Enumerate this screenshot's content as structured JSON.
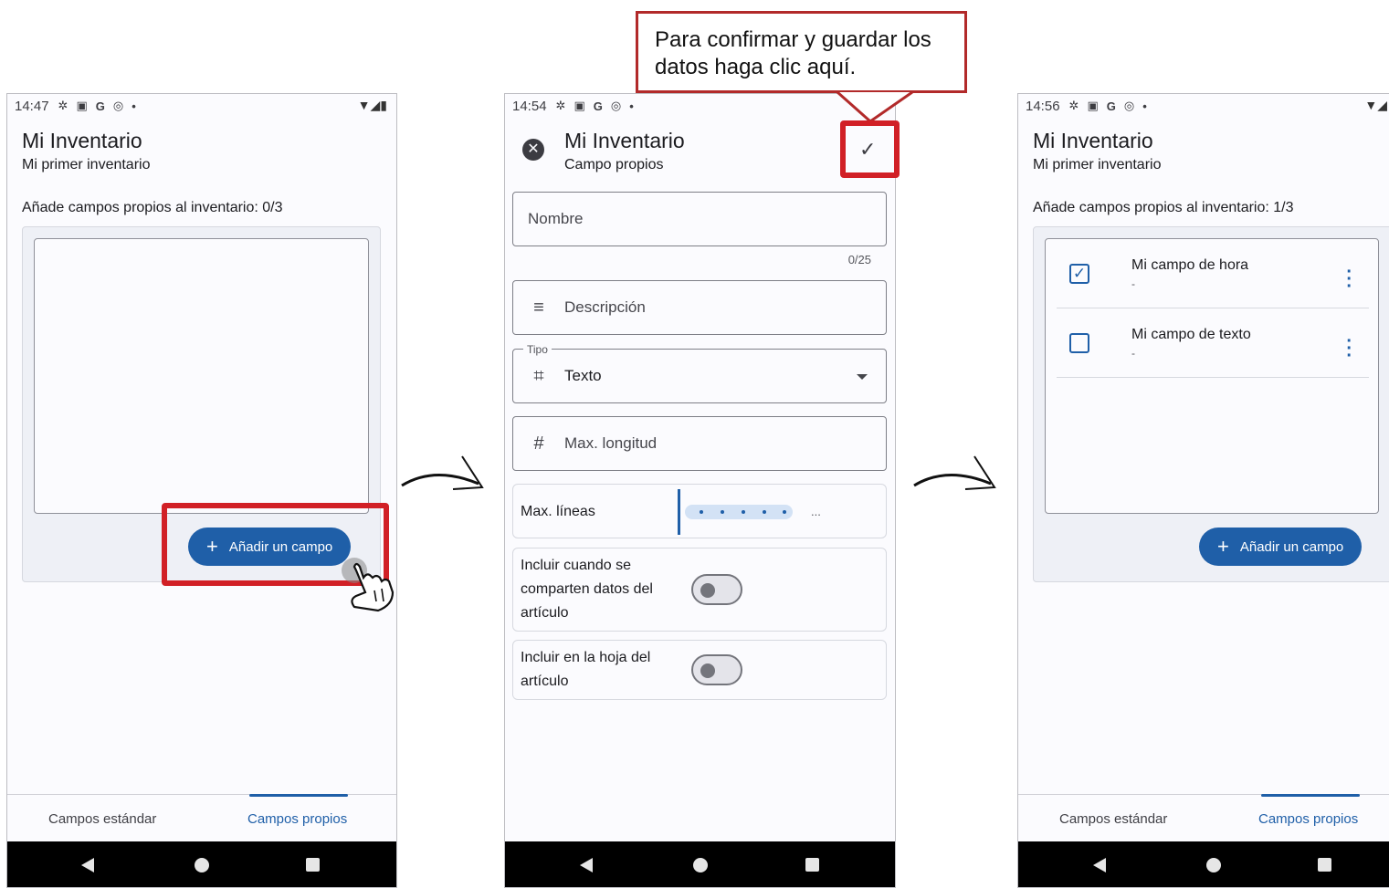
{
  "phone1": {
    "status": {
      "time": "14:47",
      "icons": [
        "gear-icon",
        "a-icon",
        "g-icon",
        "at-icon",
        "dot-icon"
      ],
      "right_icons": [
        "wifi-icon",
        "signal-icon",
        "battery-icon"
      ]
    },
    "title": "Mi Inventario",
    "subtitle": "Mi primer inventario",
    "section_label": "Añade campos propios al inventario: 0/3",
    "add_button": "Añadir un campo",
    "tabs": [
      "Campos estándar",
      "Campos propios"
    ],
    "active_tab": 1
  },
  "phone2": {
    "status": {
      "time": "14:54",
      "icons": [
        "gear-icon",
        "a-icon",
        "g-icon",
        "at-icon",
        "dot-icon"
      ]
    },
    "title": "Mi Inventario",
    "subtitle": "Campo propios",
    "fields": {
      "name_placeholder": "Nombre",
      "name_counter": "0/25",
      "description_placeholder": "Descripción",
      "type_label": "Tipo",
      "type_value": "Texto",
      "max_length_placeholder": "Max. longitud",
      "max_lines_label": "Max. líneas",
      "max_lines_ellipsis": "...",
      "share_label": "Incluir cuando se comparten datos del artículo",
      "share_lines": [
        "Incluir cuando se",
        "comparten datos del",
        "artículo"
      ],
      "sheet_lines": [
        "Incluir en la hoja del",
        "artículo"
      ]
    },
    "toggles": {
      "share": false,
      "sheet": false
    }
  },
  "phone3": {
    "status": {
      "time": "14:56",
      "icons": [
        "gear-icon",
        "a-icon",
        "g-icon",
        "at-icon",
        "dot-icon"
      ]
    },
    "title": "Mi Inventario",
    "subtitle": "Mi primer inventario",
    "section_label": "Añade campos propios al inventario: 1/3",
    "items": [
      {
        "title": "Mi campo de hora",
        "sub": "-",
        "checked": true
      },
      {
        "title": "Mi campo de texto",
        "sub": "-",
        "checked": false
      }
    ],
    "add_button": "Añadir un campo",
    "tabs": [
      "Campos estándar",
      "Campos propios"
    ],
    "active_tab": 1
  },
  "callout": {
    "line1": "Para confirmar y guardar los",
    "line2": "datos haga clic aquí."
  },
  "colors": {
    "accent": "#1f5fa8",
    "highlight": "#d12026",
    "surface": "#fbfbfe"
  }
}
